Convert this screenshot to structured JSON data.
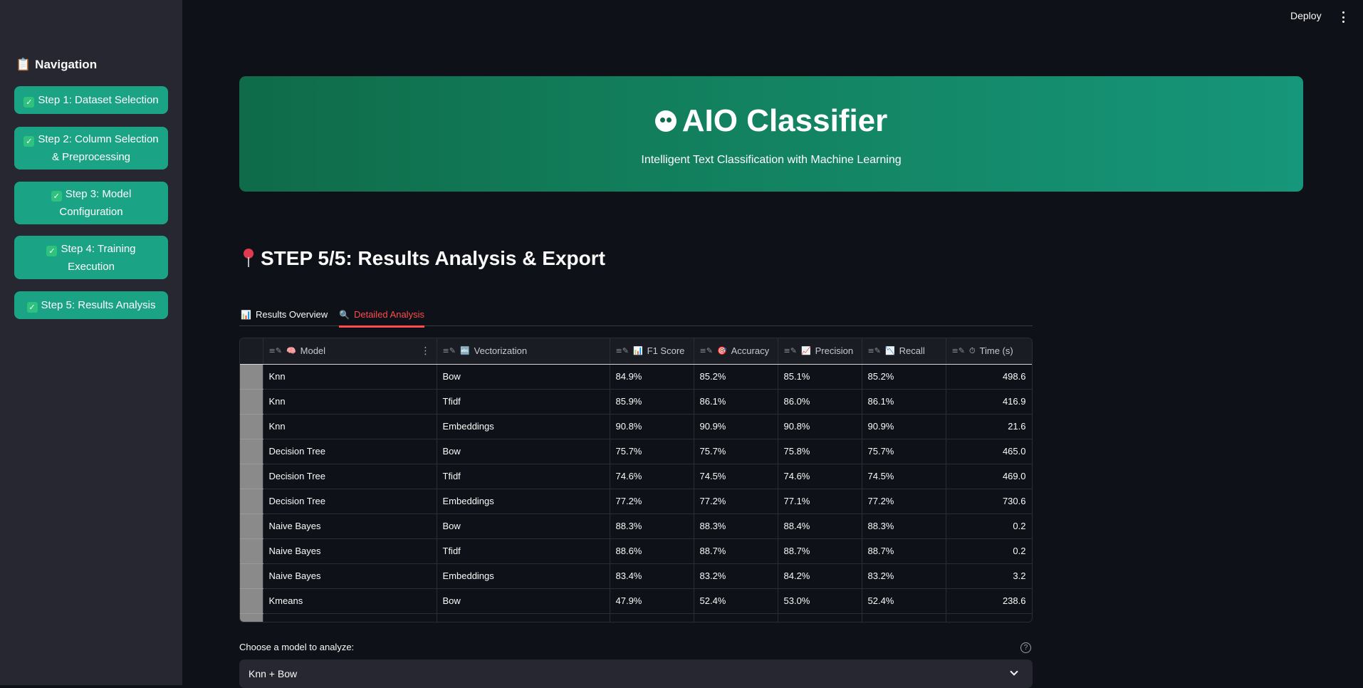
{
  "sidebar": {
    "title": "Navigation",
    "title_icon": "📋",
    "steps": [
      {
        "label": "Step 1: Dataset Selection"
      },
      {
        "label": "Step 2: Column Selection & Preprocessing"
      },
      {
        "label": "Step 3: Model Configuration"
      },
      {
        "label": "Step 4: Training Execution"
      },
      {
        "label": "Step 5: Results Analysis"
      }
    ]
  },
  "header": {
    "deploy_label": "Deploy"
  },
  "hero": {
    "title": "AIO Classifier",
    "subtitle": "Intelligent Text Classification with Machine Learning"
  },
  "step": {
    "title": "STEP 5/5: Results Analysis & Export"
  },
  "tabs": [
    {
      "label": "Results Overview",
      "icon": "📊",
      "active": false
    },
    {
      "label": "Detailed Analysis",
      "icon": "🔍",
      "active": true
    }
  ],
  "table": {
    "columns": [
      {
        "label": "Model",
        "icon": "🧠"
      },
      {
        "label": "Vectorization",
        "icon": "🔤"
      },
      {
        "label": "F1 Score",
        "icon": "📊"
      },
      {
        "label": "Accuracy",
        "icon": "🎯"
      },
      {
        "label": "Precision",
        "icon": "📈"
      },
      {
        "label": "Recall",
        "icon": "📉"
      },
      {
        "label": "Time (s)",
        "icon": "⏱"
      }
    ],
    "rows": [
      [
        "Knn",
        "Bow",
        "84.9%",
        "85.2%",
        "85.1%",
        "85.2%",
        "498.6"
      ],
      [
        "Knn",
        "Tfidf",
        "85.9%",
        "86.1%",
        "86.0%",
        "86.1%",
        "416.9"
      ],
      [
        "Knn",
        "Embeddings",
        "90.8%",
        "90.9%",
        "90.8%",
        "90.9%",
        "21.6"
      ],
      [
        "Decision Tree",
        "Bow",
        "75.7%",
        "75.7%",
        "75.8%",
        "75.7%",
        "465.0"
      ],
      [
        "Decision Tree",
        "Tfidf",
        "74.6%",
        "74.5%",
        "74.6%",
        "74.5%",
        "469.0"
      ],
      [
        "Decision Tree",
        "Embeddings",
        "77.2%",
        "77.2%",
        "77.1%",
        "77.2%",
        "730.6"
      ],
      [
        "Naive Bayes",
        "Bow",
        "88.3%",
        "88.3%",
        "88.4%",
        "88.3%",
        "0.2"
      ],
      [
        "Naive Bayes",
        "Tfidf",
        "88.6%",
        "88.7%",
        "88.7%",
        "88.7%",
        "0.2"
      ],
      [
        "Naive Bayes",
        "Embeddings",
        "83.4%",
        "83.2%",
        "84.2%",
        "83.2%",
        "3.2"
      ],
      [
        "Kmeans",
        "Bow",
        "47.9%",
        "52.4%",
        "53.0%",
        "52.4%",
        "238.6"
      ]
    ]
  },
  "model_select": {
    "label": "Choose a model to analyze:",
    "value": "Knn + Bow"
  },
  "colors": {
    "accent": "#ff4b4b",
    "nav_button": "#1aa385",
    "hero_start": "#0f6b49",
    "hero_end": "#16967a"
  }
}
